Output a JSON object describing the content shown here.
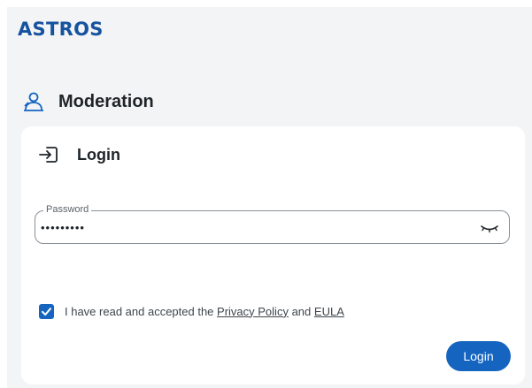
{
  "brand": {
    "logo_text": "ASTROS",
    "color": "#16539e"
  },
  "section": {
    "title": "Moderation",
    "icon": "user-icon"
  },
  "card": {
    "title": "Login",
    "icon": "login-icon",
    "password": {
      "label": "Password",
      "value": "•••••••••",
      "toggle_icon": "eye-closed-icon"
    },
    "consent": {
      "checked": true,
      "text_before": "I have read and accepted the",
      "privacy_link": "Privacy Policy",
      "conjunction": "and",
      "eula_link": "EULA"
    },
    "login_button": "Login"
  },
  "colors": {
    "accent": "#1565c0",
    "background": "#f3f4f6",
    "card": "#ffffff"
  }
}
